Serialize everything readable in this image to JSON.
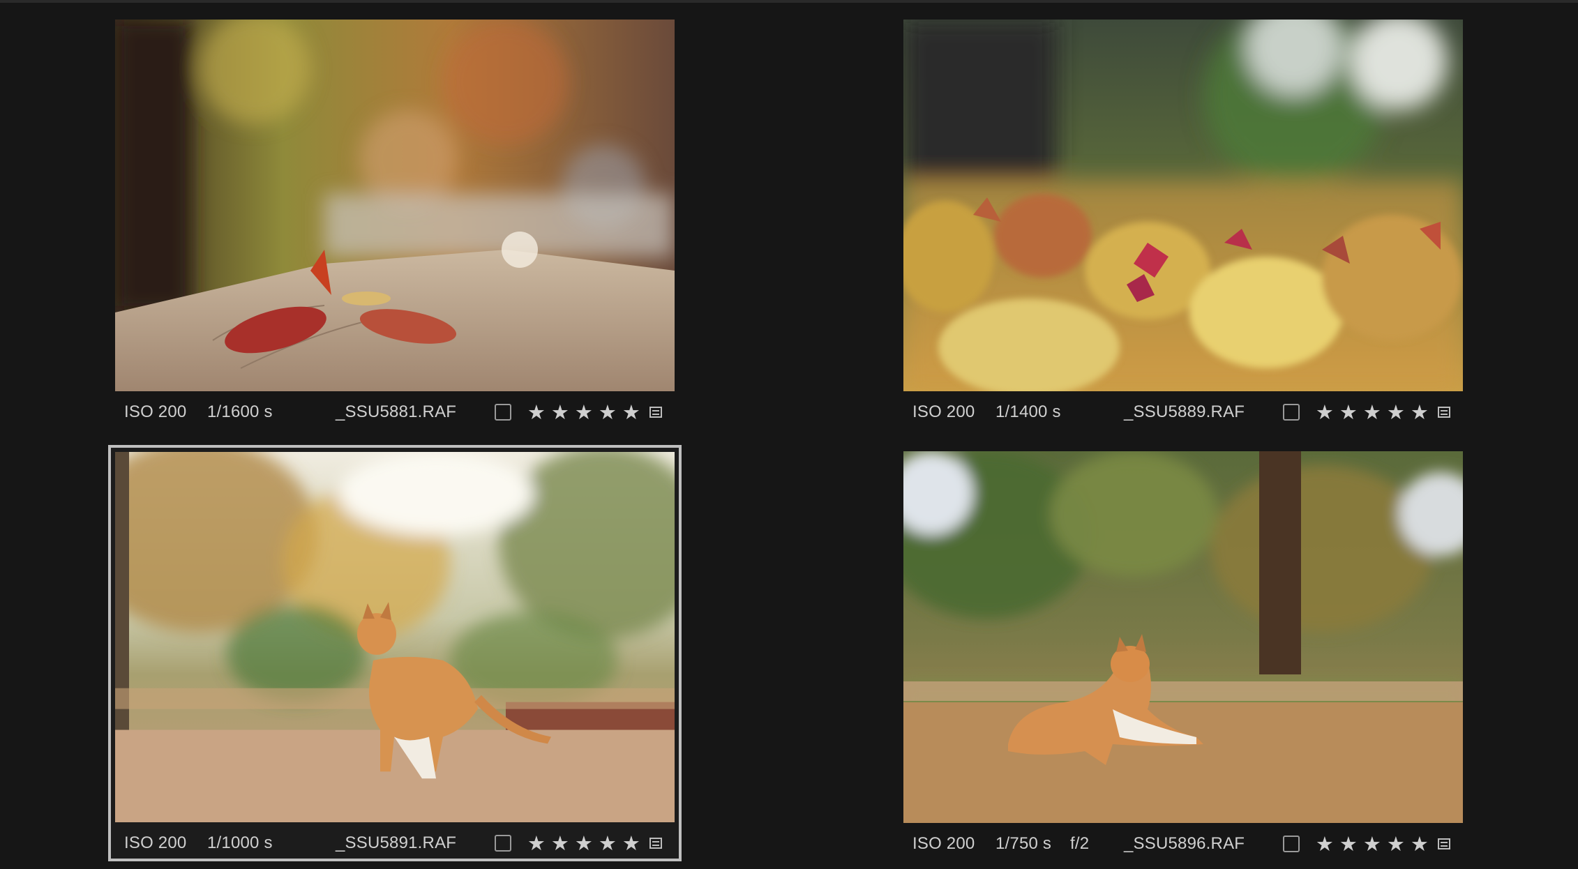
{
  "photos": [
    {
      "iso": "ISO 200",
      "shutter": "1/1600 s",
      "aperture": "",
      "filename": "_SSU5881.RAF",
      "checked": false,
      "rating_max": 5,
      "selected": false,
      "image": "fallen-leaves-on-wooden-bench"
    },
    {
      "iso": "ISO 200",
      "shutter": "1/1400 s",
      "aperture": "",
      "filename": "_SSU5889.RAF",
      "checked": false,
      "rating_max": 5,
      "selected": false,
      "image": "autumn-shrub-leaves"
    },
    {
      "iso": "ISO 200",
      "shutter": "1/1000 s",
      "aperture": "",
      "filename": "_SSU5891.RAF",
      "checked": false,
      "rating_max": 5,
      "selected": true,
      "image": "orange-cat-walking-away"
    },
    {
      "iso": "ISO 200",
      "shutter": "1/750 s",
      "aperture": "f/2",
      "filename": "_SSU5896.RAF",
      "checked": false,
      "rating_max": 5,
      "selected": false,
      "image": "orange-cat-lying-in-grass"
    }
  ],
  "star_glyph": "★",
  "colors": {
    "background": "#161616",
    "selection_border": "#bfbfbf",
    "text": "#d0d0d0"
  }
}
